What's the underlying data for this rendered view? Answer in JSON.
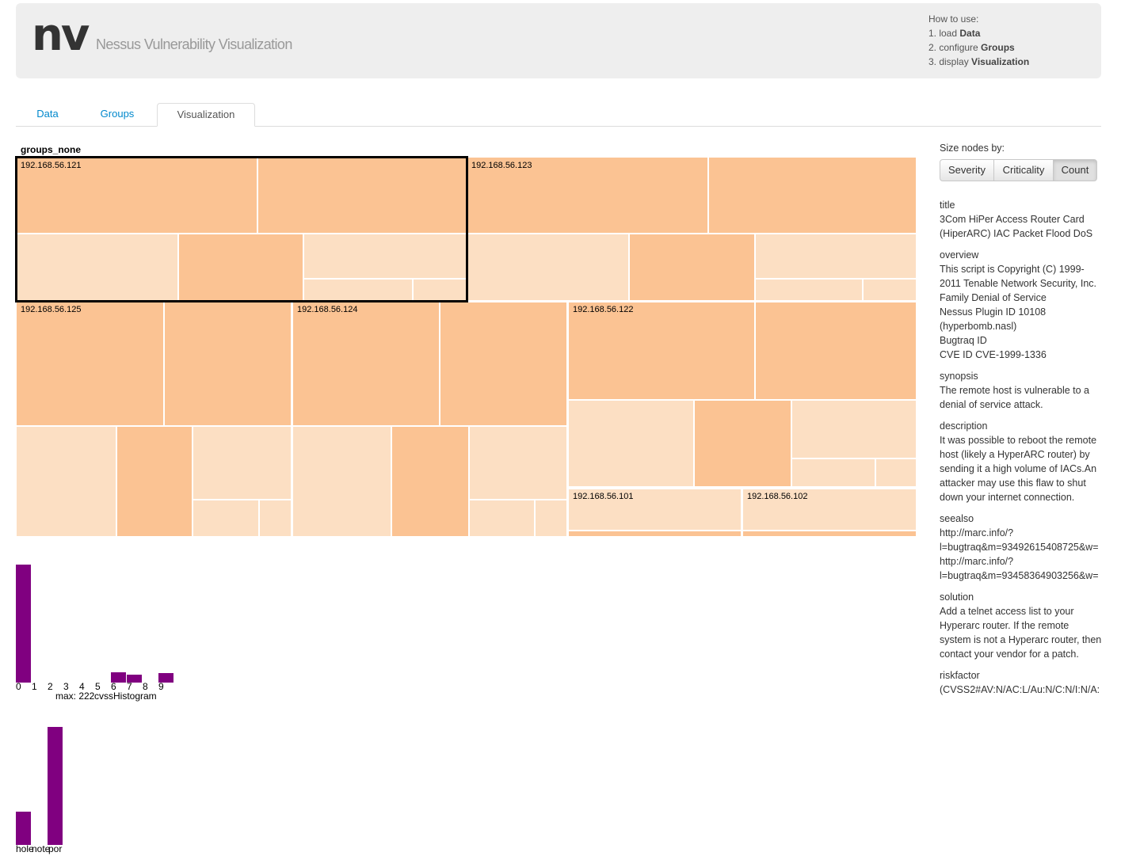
{
  "header": {
    "logo": "nv",
    "subtitle": "Nessus Vulnerability Visualization",
    "howto_title": "How to use:",
    "steps": [
      {
        "prefix": "1. load ",
        "bold": "Data"
      },
      {
        "prefix": "2. configure ",
        "bold": "Groups"
      },
      {
        "prefix": "3. display ",
        "bold": "Visualization"
      }
    ]
  },
  "tabs": [
    {
      "label": "Data",
      "active": false
    },
    {
      "label": "Groups",
      "active": false
    },
    {
      "label": "Visualization",
      "active": true
    }
  ],
  "treemap": {
    "group_title": "groups_none",
    "hosts": [
      "192.168.56.121",
      "192.168.56.123",
      "192.168.56.125",
      "192.168.56.124",
      "192.168.56.122",
      "192.168.56.101",
      "192.168.56.102"
    ],
    "selected_host": "192.168.56.121",
    "colors": {
      "dark": "#fbc393",
      "light": "#fcdfc3"
    }
  },
  "cvss_histogram": {
    "ticks": [
      "0",
      "1",
      "2",
      "3",
      "4",
      "5",
      "6",
      "7",
      "8",
      "9"
    ],
    "max_label": "max: 222",
    "title": "cvssHistogram",
    "color": "#800080"
  },
  "severity_histogram": {
    "labels": [
      "hole",
      "note",
      "por"
    ],
    "bar_color": "#800080"
  },
  "size_nodes": {
    "label": "Size nodes by:",
    "buttons": [
      "Severity",
      "Criticality",
      "Count"
    ],
    "active": "Count"
  },
  "details": [
    {
      "key": "title",
      "value": "3Com HiPer Access Router Card (HiperARC) IAC Packet Flood DoS"
    },
    {
      "key": "overview",
      "value": "This script is Copyright (C) 1999-2011 Tenable Network Security, Inc.",
      "extra": [
        "Family Denial of Service",
        "Nessus Plugin ID 10108",
        "(hyperbomb.nasl)",
        "Bugtraq ID",
        "CVE ID CVE-1999-1336"
      ]
    },
    {
      "key": "synopsis",
      "value": "The remote host is vulnerable to a denial of service attack."
    },
    {
      "key": "description",
      "value": "It was possible to reboot the remote host (likely a HyperARC router) by sending it a high volume of IACs.An attacker may use this flaw to shut down your internet connection."
    },
    {
      "key": "seealso",
      "lines": [
        "http://marc.info/?",
        "l=bugtraq&m=93492615408725&w=",
        "http://marc.info/?",
        "l=bugtraq&m=93458364903256&w="
      ]
    },
    {
      "key": "solution",
      "value": "Add a telnet access list to your Hyperarc router. If the remote system is not a Hyperarc router, then contact your vendor for a patch."
    },
    {
      "key": "riskfactor",
      "lines": [
        "(CVSS2#AV:N/AC:L/Au:N/C:N/I:N/A:"
      ]
    }
  ]
}
